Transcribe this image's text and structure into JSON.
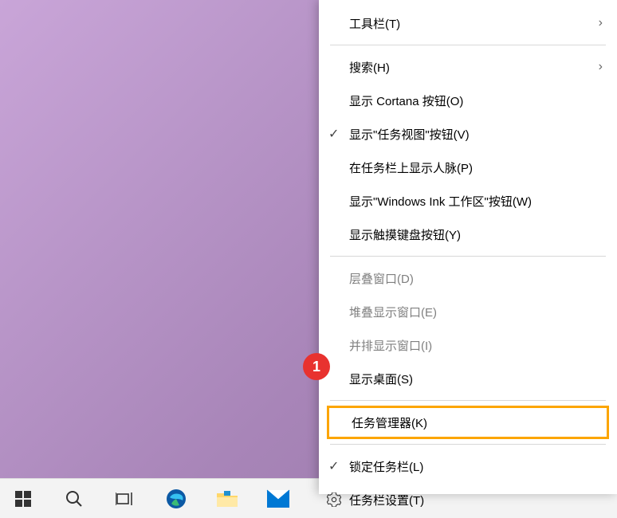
{
  "menu": {
    "toolbars": "工具栏(T)",
    "search": "搜索(H)",
    "show_cortana": "显示 Cortana 按钮(O)",
    "show_task_view": "显示\"任务视图\"按钮(V)",
    "show_people": "在任务栏上显示人脉(P)",
    "show_ink": "显示\"Windows Ink 工作区\"按钮(W)",
    "show_touch_keyboard": "显示触摸键盘按钮(Y)",
    "cascade_windows": "层叠窗口(D)",
    "stacked_windows": "堆叠显示窗口(E)",
    "side_by_side": "并排显示窗口(I)",
    "show_desktop": "显示桌面(S)",
    "task_manager": "任务管理器(K)",
    "lock_taskbar": "锁定任务栏(L)",
    "taskbar_settings": "任务栏设置(T)"
  },
  "annotation": {
    "number": "1"
  },
  "taskbar": {
    "start": "start",
    "search": "search",
    "taskview": "task-view",
    "edge": "edge",
    "explorer": "file-explorer",
    "mail": "mail"
  }
}
